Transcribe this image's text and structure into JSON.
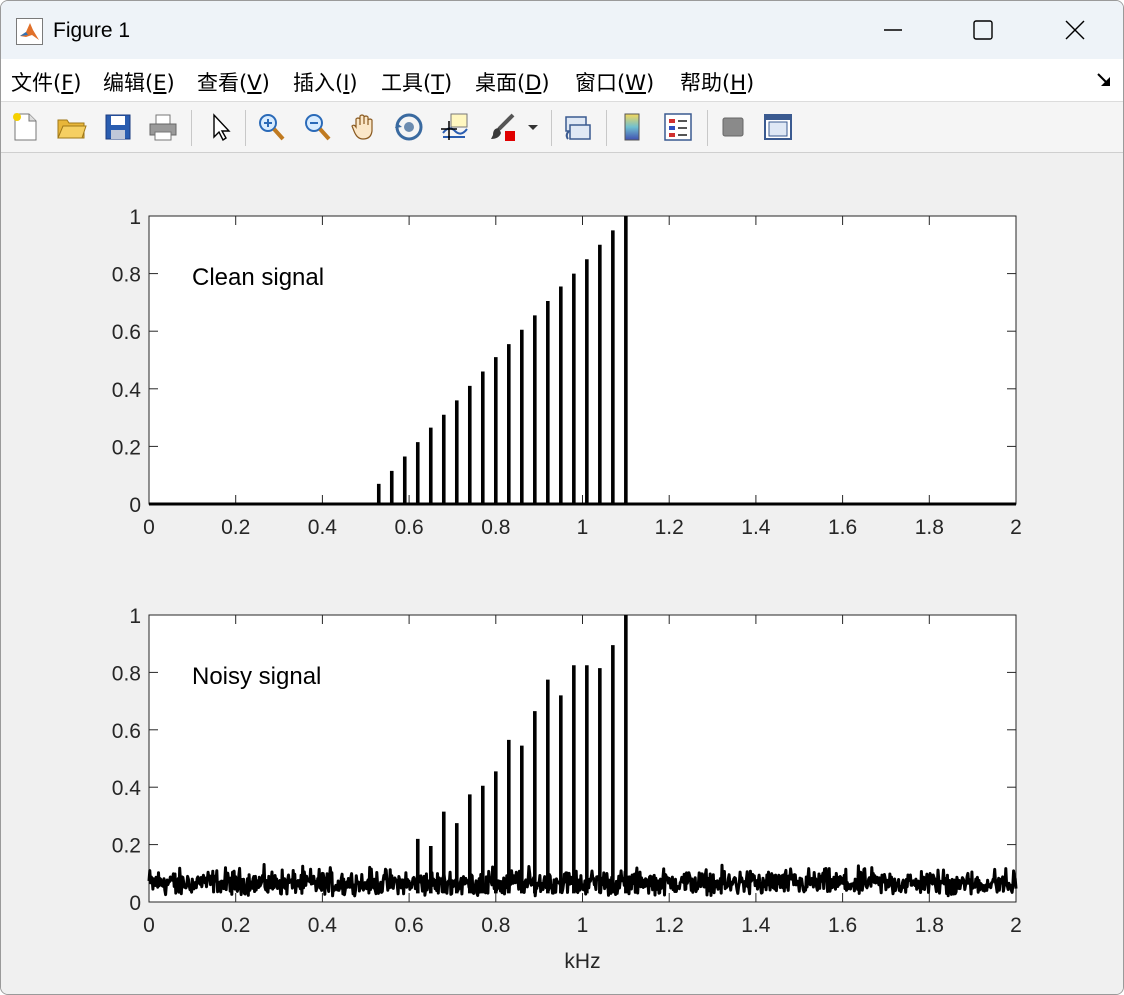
{
  "window": {
    "title": "Figure 1"
  },
  "menu": [
    {
      "label": "文件(",
      "key": "F",
      "end": ")"
    },
    {
      "label": "编辑(",
      "key": "E",
      "end": ")"
    },
    {
      "label": "查看(",
      "key": "V",
      "end": ")"
    },
    {
      "label": "插入(",
      "key": "I",
      "end": ")"
    },
    {
      "label": "工具(",
      "key": "T",
      "end": ")"
    },
    {
      "label": "桌面(",
      "key": "D",
      "end": ")"
    },
    {
      "label": "窗口(",
      "key": "W",
      "end": ")"
    },
    {
      "label": "帮助(",
      "key": "H",
      "end": ")"
    }
  ],
  "toolbar_icons": [
    "new-file-icon",
    "open-folder-icon",
    "save-icon",
    "print-icon",
    "pointer-icon",
    "zoom-in-icon",
    "zoom-out-icon",
    "pan-hand-icon",
    "rotate-3d-icon",
    "data-cursor-icon",
    "brush-icon",
    "link-plot-icon",
    "colorbar-icon",
    "legend-icon",
    "hide-plot-tools-icon",
    "show-plot-tools-icon"
  ],
  "chart_data": [
    {
      "type": "line",
      "annotation": "Clean signal",
      "xlim": [
        0,
        2
      ],
      "ylim": [
        0,
        1
      ],
      "xticks": [
        "0",
        "0.2",
        "0.4",
        "0.6",
        "0.8",
        "1",
        "1.2",
        "1.4",
        "1.6",
        "1.8",
        "2"
      ],
      "yticks": [
        "0",
        "0.2",
        "0.4",
        "0.6",
        "0.8",
        "1"
      ],
      "xlabel": "",
      "baseline": 0,
      "peaks": {
        "x": [
          0.53,
          0.56,
          0.59,
          0.62,
          0.65,
          0.68,
          0.71,
          0.74,
          0.77,
          0.8,
          0.83,
          0.86,
          0.89,
          0.92,
          0.95,
          0.98,
          1.01,
          1.04,
          1.07,
          1.1
        ],
        "y": [
          0.07,
          0.115,
          0.165,
          0.215,
          0.265,
          0.31,
          0.36,
          0.41,
          0.46,
          0.51,
          0.555,
          0.605,
          0.655,
          0.705,
          0.755,
          0.8,
          0.85,
          0.9,
          0.95,
          1.0
        ]
      }
    },
    {
      "type": "line",
      "annotation": "Noisy signal",
      "xlim": [
        0,
        2
      ],
      "ylim": [
        0,
        1
      ],
      "xticks": [
        "0",
        "0.2",
        "0.4",
        "0.6",
        "0.8",
        "1",
        "1.2",
        "1.4",
        "1.6",
        "1.8",
        "2"
      ],
      "yticks": [
        "0",
        "0.2",
        "0.4",
        "0.6",
        "0.8",
        "1"
      ],
      "xlabel": "kHz",
      "noise_floor": [
        0.0,
        0.14
      ],
      "peaks": {
        "x": [
          0.62,
          0.65,
          0.68,
          0.71,
          0.74,
          0.77,
          0.8,
          0.83,
          0.86,
          0.89,
          0.92,
          0.95,
          0.98,
          1.01,
          1.04,
          1.07,
          1.1
        ],
        "y": [
          0.22,
          0.195,
          0.315,
          0.275,
          0.375,
          0.405,
          0.455,
          0.565,
          0.545,
          0.665,
          0.775,
          0.72,
          0.825,
          0.825,
          0.815,
          0.895,
          1.0
        ]
      }
    }
  ]
}
